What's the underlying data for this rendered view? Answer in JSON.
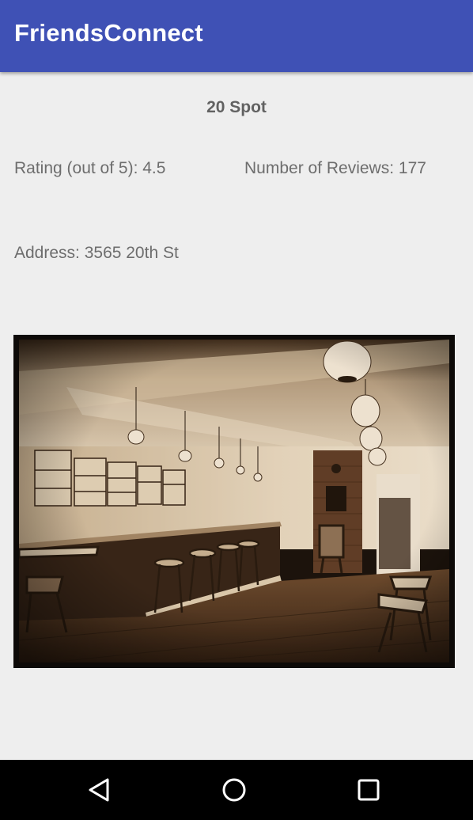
{
  "app": {
    "title": "FriendsConnect"
  },
  "place": {
    "name": "20 Spot",
    "rating_text": "Rating (out of 5): 4.5",
    "reviews_text": "Number of Reviews: 177",
    "address_text": "Address: 3565 20th St"
  },
  "photo": {
    "tone": "sepia"
  },
  "navigation": {
    "back_icon": "back-triangle-icon",
    "home_icon": "home-circle-icon",
    "recents_icon": "recents-square-icon"
  },
  "colors": {
    "app_bar": "#3f51b5",
    "background": "#eeeeee",
    "text": "#6d6d6d",
    "nav_bar": "#000000"
  }
}
